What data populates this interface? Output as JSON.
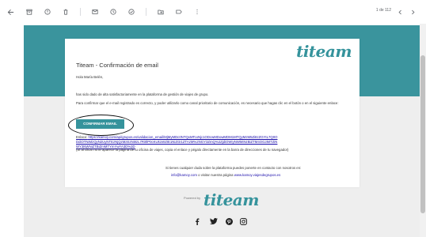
{
  "toolbar": {
    "back_icon": "arrow-back-icon",
    "icons": [
      "archive-icon",
      "report-spam-icon",
      "delete-icon",
      "mark-unread-icon",
      "snooze-icon",
      "add-to-tasks-icon",
      "move-to-icon",
      "label-icon",
      "more-icon"
    ],
    "pagination": "1 de 112"
  },
  "colors": {
    "teal": "#35939c",
    "band": "#3a949d",
    "page_bg": "#eeeeee"
  },
  "email": {
    "logo": "titeam",
    "title": "Titeam - Confirmación de email",
    "greeting": "Hola María Belén,",
    "p1": "has sido dado de alta satisfactoriamente en la plataforma de gestión de viajes de grupo.",
    "p2": "Para confirmar que el e-mail registrado es correcto, y poder utilizarlo como canal prioritario de comunicación, es necesario que hagas clic en el botón o en el siguiente enlace:",
    "button_label": "CONFIRMAR EMAIL",
    "link_lead": "Enlace:",
    "link_url": "https://kamoy.com/api/grupos.es/validacion_email/MjMyMDc0NTQxMTcxNjc1ODcwMDowMDM1MTQyMzM5Zi8zZGYtL7Q0ODdiOTNiMzQyN2UyNTEzNjQzMzEzNi8zL7Ri0lP0cKUk1WZIE1NiZGI1ZTAzM%2NGY3ZmQ%2ZjdiOWIyNWMiNzBiZTM4OGJiMTZiNWY3NWNiZTBiZmMTYmYwYA3D%3D",
    "note": "(Si al clicar no te aparece la página de tu oficina de viajes, copia el enlace y pégalo directamente en la barra de direcciones de tu navegador)",
    "contact_line1": "Si tienes cualquier duda sobre la plataforma puedes ponerte en contacto con nosotros en:",
    "contact_email": "info@kamoy.com",
    "contact_middle": " o visitar nuestra página ",
    "contact_site": "www.kamoy.viajesdegrupos.es"
  },
  "footer": {
    "powered_by": "Powered by",
    "logo": "titeam",
    "social": [
      "facebook-icon",
      "twitter-icon",
      "pinterest-icon",
      "instagram-icon"
    ]
  }
}
